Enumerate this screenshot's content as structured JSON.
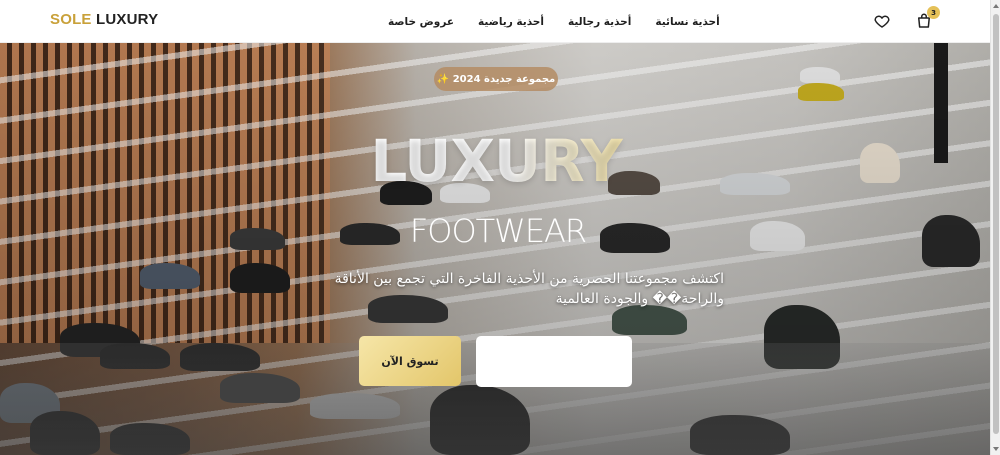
{
  "logo": {
    "part1": "SOLE",
    "part2": " LUXURY"
  },
  "nav": {
    "links": [
      "عروض خاصة",
      "أحذية رياضية",
      "أحذية رجالية",
      "أحذية نسائية"
    ],
    "cart_count": "3"
  },
  "hero": {
    "badge": "مجموعة جديدة 2024 ✨",
    "title": "LUXURY",
    "subtitle": "FOOTWEAR",
    "description": "اكتشف مجموعتنا الحصرية من الأحذية الفاخرة التي تجمع بين الأناقة والراحة�� والجودة العالمية",
    "primary_button": "تسوق الآن",
    "secondary_button": ""
  },
  "colors": {
    "accent": "#e5c158",
    "logo_gold": "#c9a13a",
    "text_dark": "#1f1f1f"
  },
  "icons": [
    "heart-icon",
    "cart-icon"
  ]
}
